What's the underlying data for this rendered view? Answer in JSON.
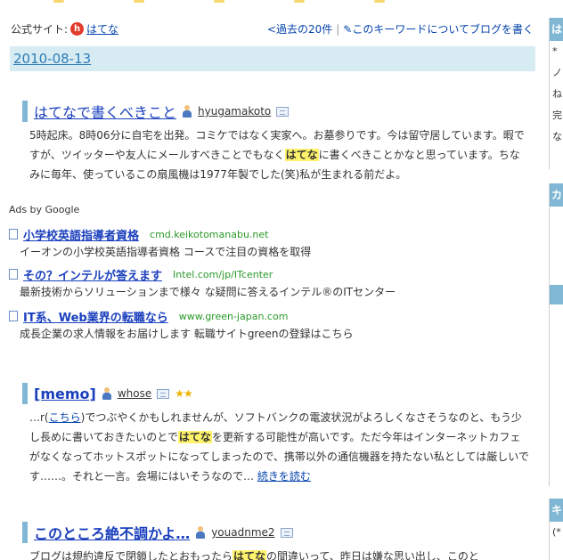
{
  "header": {
    "official_label": "公式サイト:",
    "official_icon": "h",
    "official_link": "はてな",
    "past_link": "<過去の20件",
    "separator": "|",
    "blog_link": "✎このキーワードについてブログを書く"
  },
  "date": "2010-08-13",
  "entries": [
    {
      "title": "はてなで書くべきこと",
      "user": "hyugamakoto",
      "body": [
        "5時起床。8時06分に自宅を出発。コミケではなく実家へ。お墓参りです。今は留守居しています。暇ですが、ツイッターや友人にメールすべきことでもなく",
        "はてな",
        "に書くべきことかなと思っています。ちなみに毎年、使っているこの扇風機は1977年製でした(笑)私が生まれる前だよ。"
      ]
    },
    {
      "title": "[memo]",
      "user": "whose",
      "stars": "★★",
      "body_pre": "…r(",
      "body_link": "こちら",
      "body_mid": ")でつぶやくかもしれませんが、ソフトバンクの電波状況がよろしくなさそうなのと、もう少し長めに書いておきたいのとで",
      "body_hl": "はてな",
      "body_post": "を更新する可能性が高いです。ただ今年はインターネットカフェがなくなってホットスポットになってしまったので、携帯以外の通信機器を持たない私としては厳しいです……。それと一言。会場にはいそうなので…",
      "read_more": "続きを読む"
    },
    {
      "title": "このところ絶不調かよ…",
      "user": "youadnme2",
      "body_pre": "ブログは規約違反で閉鎖したとおもったら",
      "body_hl": "はてな",
      "body_post": "の間違いって、昨日は嫌な思い出し、このと"
    }
  ],
  "ads": {
    "label": "Ads by Google",
    "items": [
      {
        "title": "小学校英語指導者資格",
        "url": "cmd.keikotomanabu.net",
        "desc": "イーオンの小学校英語指導者資格 コースで注目の資格を取得"
      },
      {
        "title": "その？インテルが答えます",
        "url": "Intel.com/jp/ITcenter",
        "desc": "最新技術からソリューションまで様々 な疑問に答えるインテル®のITセンター"
      },
      {
        "title": "IT系、Web業界の転職なら",
        "url": "www.green-japan.com",
        "desc": "成長企業の求人情報をお届けします 転職サイトgreenの登録はこちら"
      }
    ]
  },
  "sidebar": {
    "head1": "は",
    "lines1": [
      "*",
      "ノ",
      "ね",
      "完",
      "な"
    ],
    "head2": "カ",
    "head3": "キ",
    "lines3": [
      "(*"
    ]
  },
  "colors": {
    "accent_bar": "#7fb7d4",
    "date_bar_bg": "#d6ebf2",
    "highlight": "#fff36b",
    "link": "#0645ad",
    "ad_url": "#2a9a2a"
  }
}
